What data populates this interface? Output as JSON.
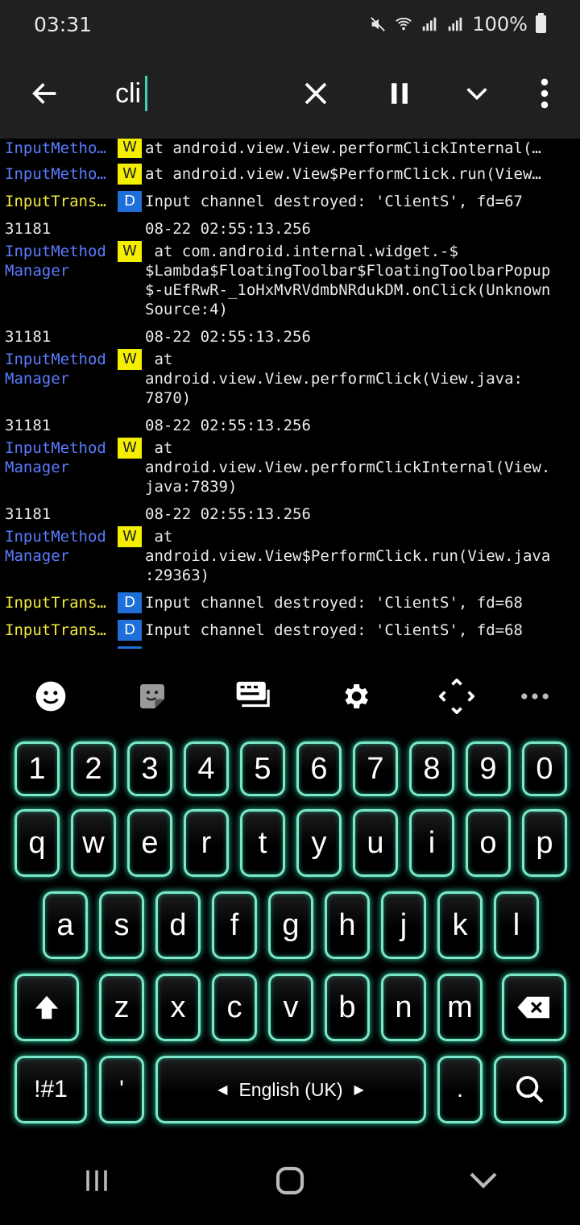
{
  "status_bar": {
    "time": "03:31",
    "battery": "100%"
  },
  "toolbar": {
    "search_value": "cli"
  },
  "log": {
    "rows": [
      {
        "tag": "InputMetho…",
        "tag_color": "blue",
        "level": "W",
        "message": " at android.view.View.performClickInternal(…"
      },
      {
        "tag": "InputMetho…",
        "tag_color": "blue",
        "level": "W",
        "message": " at android.view.View$PerformClick.run(View…"
      },
      {
        "tag": "InputTrans…",
        "tag_color": "yellow",
        "level": "D",
        "message": "Input channel destroyed: 'ClientS', fd=67"
      }
    ],
    "entries": [
      {
        "pid": "31181",
        "timestamp": "08-22 02:55:13.256",
        "tag_line1": "InputMethod",
        "tag_line2": "Manager",
        "level": "W",
        "message": " at com.android.internal.widget.-$\n$Lambda$FloatingToolbar$FloatingToolbarPopup\n$-uEfRwR-_1oHxMvRVdmbNRdukDM.onClick(Unknown\nSource:4)"
      },
      {
        "pid": "31181",
        "timestamp": "08-22 02:55:13.256",
        "tag_line1": "InputMethod",
        "tag_line2": "Manager",
        "level": "W",
        "message": " at\nandroid.view.View.performClick(View.java:\n7870)"
      },
      {
        "pid": "31181",
        "timestamp": "08-22 02:55:13.256",
        "tag_line1": "InputMethod",
        "tag_line2": "Manager",
        "level": "W",
        "message": " at\nandroid.view.View.performClickInternal(View.\njava:7839)"
      },
      {
        "pid": "31181",
        "timestamp": "08-22 02:55:13.256",
        "tag_line1": "InputMethod",
        "tag_line2": "Manager",
        "level": "W",
        "message": " at\nandroid.view.View$PerformClick.run(View.java\n:29363)"
      }
    ],
    "tail_rows": [
      {
        "tag": "InputTrans…",
        "tag_color": "yellow",
        "level": "D",
        "message": "Input channel destroyed: 'ClientS', fd=68"
      },
      {
        "tag": "InputTrans…",
        "tag_color": "yellow",
        "level": "D",
        "message": "Input channel destroyed: 'ClientS', fd=68"
      }
    ]
  },
  "keyboard": {
    "row_numbers": [
      "1",
      "2",
      "3",
      "4",
      "5",
      "6",
      "7",
      "8",
      "9",
      "0"
    ],
    "row_top": [
      "q",
      "w",
      "e",
      "r",
      "t",
      "y",
      "u",
      "i",
      "o",
      "p"
    ],
    "row_middle": [
      "a",
      "s",
      "d",
      "f",
      "g",
      "h",
      "j",
      "k",
      "l"
    ],
    "row_bottom": [
      "z",
      "x",
      "c",
      "v",
      "b",
      "n",
      "m"
    ],
    "symbols_label": "!#1",
    "apostrophe_label": "'",
    "space_label": "English (UK)",
    "period_label": "."
  }
}
